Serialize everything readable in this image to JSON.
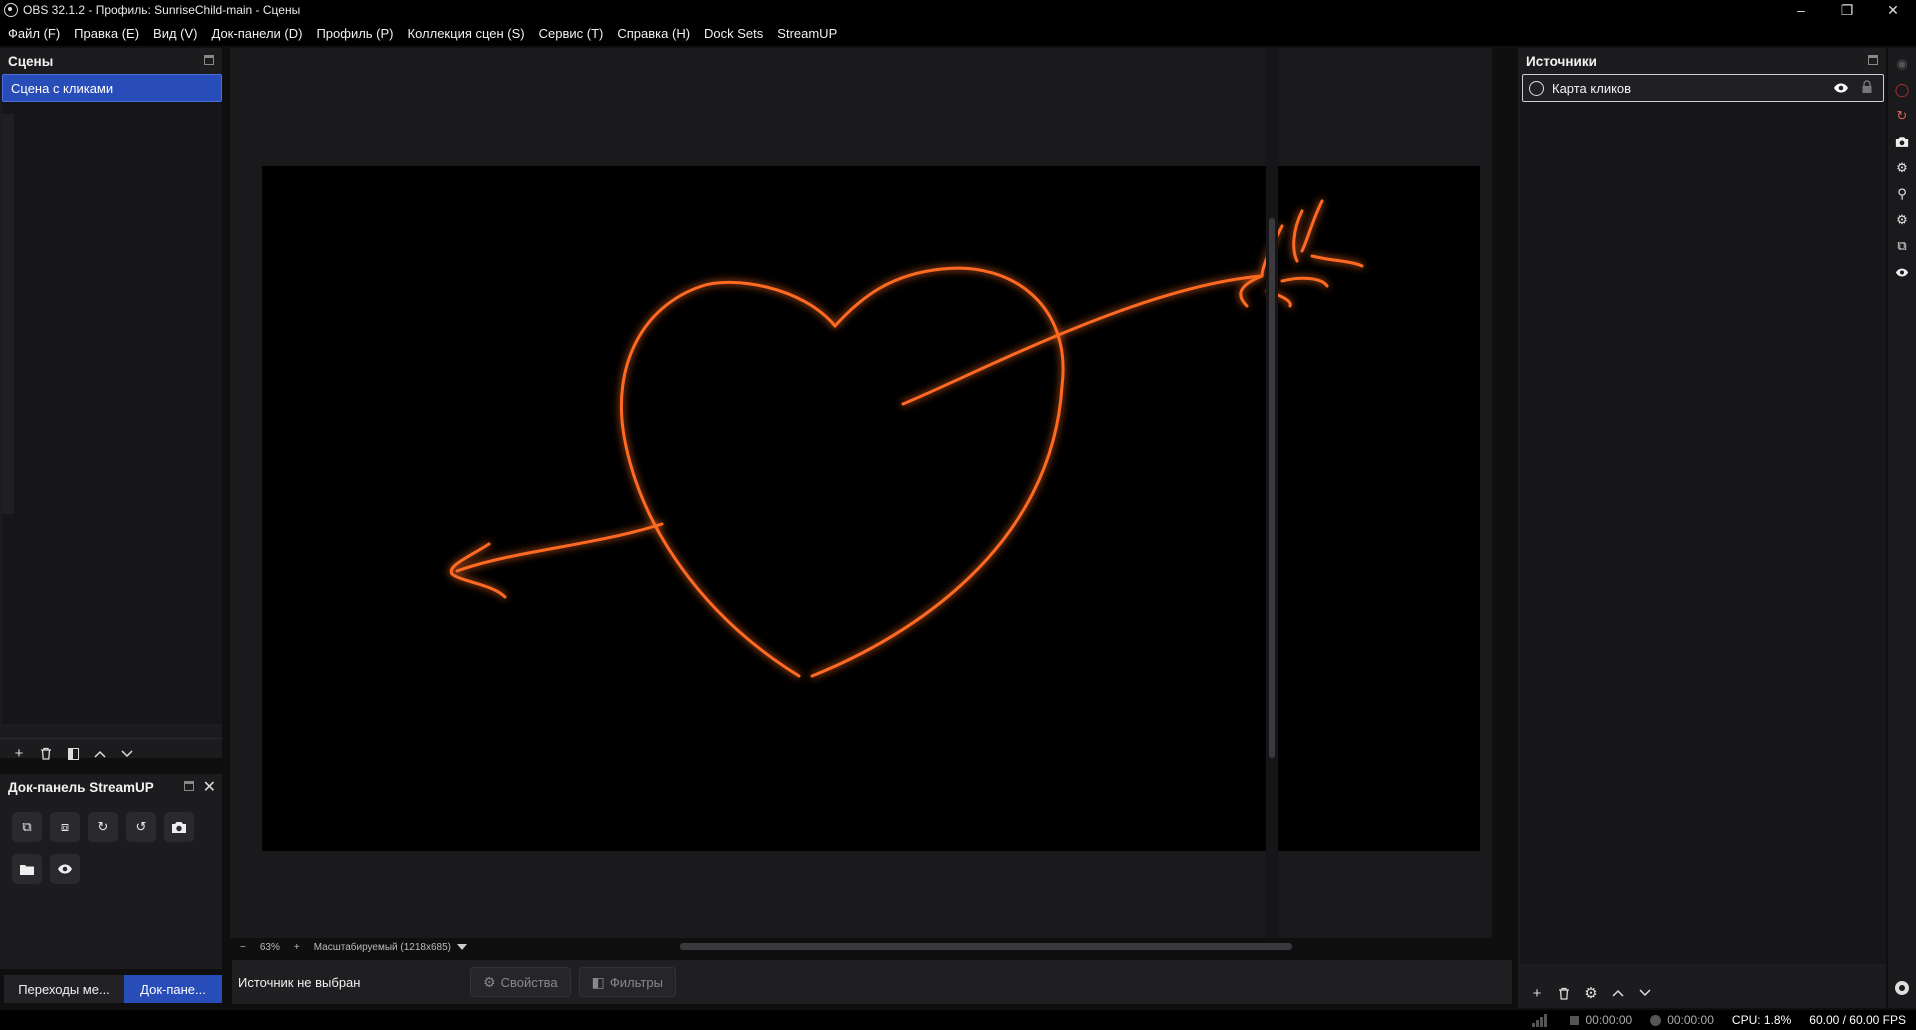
{
  "window": {
    "title": "OBS 32.1.2 - Профиль: SunriseChild-main - Сцены",
    "controls": [
      "–",
      "❐",
      "✕"
    ]
  },
  "menu": [
    "Файл (F)",
    "Правка (E)",
    "Вид (V)",
    "Док-панели (D)",
    "Профиль (P)",
    "Коллекция сцен (S)",
    "Сервис (T)",
    "Справка (H)",
    "Dock Sets",
    "StreamUP"
  ],
  "scenes": {
    "title": "Сцены",
    "items": [
      "Сцена с кликами"
    ],
    "selected": 0
  },
  "streamup": {
    "title": "Док-панель StreamUP",
    "buttons": [
      "sources-lock-icon",
      "sources-unlock-icon",
      "refresh-sources-icon",
      "refresh-audio-icon",
      "screenshot-icon",
      "folder-icon",
      "visibility-icon"
    ]
  },
  "bottom_tabs": [
    "Переходы ме...",
    "Док-пане..."
  ],
  "preview": {
    "zoom": "63%",
    "scale_mode": "Масштабируемый (1218x685)",
    "stroke_color": "#ff6a20",
    "glow_color": "#ff3a00"
  },
  "context": {
    "no_source": "Источник не выбран",
    "properties": "Свойства",
    "filters": "Фильтры"
  },
  "sources": {
    "title": "Источники",
    "items": [
      "Карта кликов"
    ]
  },
  "status": {
    "stream_time": "00:00:00",
    "rec_time": "00:00:00",
    "cpu": "CPU: 1.8%",
    "fps": "60.00 / 60.00 FPS"
  },
  "colors": {
    "accent": "#284cb8",
    "panel": "#1c1c1f",
    "background": "#0f0f10"
  }
}
